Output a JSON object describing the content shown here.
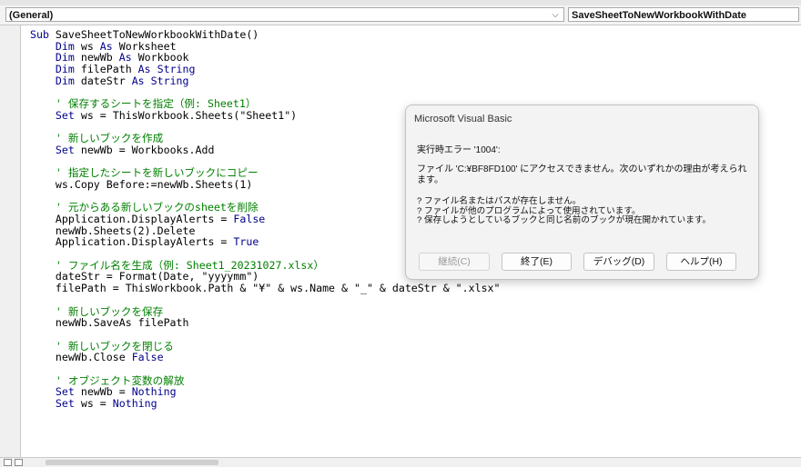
{
  "object_combo": {
    "value": "(General)",
    "arrow": "⌵"
  },
  "procedure_combo": {
    "value": "SaveSheetToNewWorkbookWithDate"
  },
  "code_lines": [
    [
      {
        "t": "Sub ",
        "c": "kw"
      },
      {
        "t": "SaveSheetToNewWorkbookWithDate()"
      }
    ],
    [
      {
        "t": "    "
      },
      {
        "t": "Dim ",
        "c": "kw"
      },
      {
        "t": "ws "
      },
      {
        "t": "As ",
        "c": "kw"
      },
      {
        "t": "Worksheet"
      }
    ],
    [
      {
        "t": "    "
      },
      {
        "t": "Dim ",
        "c": "kw"
      },
      {
        "t": "newWb "
      },
      {
        "t": "As ",
        "c": "kw"
      },
      {
        "t": "Workbook"
      }
    ],
    [
      {
        "t": "    "
      },
      {
        "t": "Dim ",
        "c": "kw"
      },
      {
        "t": "filePath "
      },
      {
        "t": "As String",
        "c": "kw"
      }
    ],
    [
      {
        "t": "    "
      },
      {
        "t": "Dim ",
        "c": "kw"
      },
      {
        "t": "dateStr "
      },
      {
        "t": "As String",
        "c": "kw"
      }
    ],
    [],
    [
      {
        "t": "    "
      },
      {
        "t": "' 保存するシートを指定（例: Sheet1）",
        "c": "cm"
      }
    ],
    [
      {
        "t": "    "
      },
      {
        "t": "Set ",
        "c": "kw"
      },
      {
        "t": "ws = ThisWorkbook.Sheets(\"Sheet1\")"
      }
    ],
    [],
    [
      {
        "t": "    "
      },
      {
        "t": "' 新しいブックを作成",
        "c": "cm"
      }
    ],
    [
      {
        "t": "    "
      },
      {
        "t": "Set ",
        "c": "kw"
      },
      {
        "t": "newWb = Workbooks.Add"
      }
    ],
    [],
    [
      {
        "t": "    "
      },
      {
        "t": "' 指定したシートを新しいブックにコピー",
        "c": "cm"
      }
    ],
    [
      {
        "t": "    ws.Copy Before:=newWb.Sheets(1)"
      }
    ],
    [],
    [
      {
        "t": "    "
      },
      {
        "t": "' 元からある新しいブックのsheetを削除",
        "c": "cm"
      }
    ],
    [
      {
        "t": "    Application.DisplayAlerts = "
      },
      {
        "t": "False",
        "c": "kw"
      }
    ],
    [
      {
        "t": "    newWb.Sheets(2).Delete"
      }
    ],
    [
      {
        "t": "    Application.DisplayAlerts = "
      },
      {
        "t": "True",
        "c": "kw"
      }
    ],
    [],
    [
      {
        "t": "    "
      },
      {
        "t": "' ファイル名を生成（例: Sheet1_20231027.xlsx）",
        "c": "cm"
      }
    ],
    [
      {
        "t": "    dateStr = Format(Date, \"yyyymm\")"
      }
    ],
    [
      {
        "t": "    filePath = ThisWorkbook.Path & \"¥\" & ws.Name & \"_\" & dateStr & \".xlsx\""
      }
    ],
    [],
    [
      {
        "t": "    "
      },
      {
        "t": "' 新しいブックを保存",
        "c": "cm"
      }
    ],
    [
      {
        "t": "    newWb.SaveAs filePath"
      }
    ],
    [],
    [
      {
        "t": "    "
      },
      {
        "t": "' 新しいブックを閉じる",
        "c": "cm"
      }
    ],
    [
      {
        "t": "    newWb.Close "
      },
      {
        "t": "False",
        "c": "kw"
      }
    ],
    [],
    [
      {
        "t": "    "
      },
      {
        "t": "' オブジェクト変数の解放",
        "c": "cm"
      }
    ],
    [
      {
        "t": "    "
      },
      {
        "t": "Set ",
        "c": "kw"
      },
      {
        "t": "newWb = "
      },
      {
        "t": "Nothing",
        "c": "kw"
      }
    ],
    [
      {
        "t": "    "
      },
      {
        "t": "Set ",
        "c": "kw"
      },
      {
        "t": "ws = "
      },
      {
        "t": "Nothing",
        "c": "kw"
      }
    ]
  ],
  "dialog": {
    "title": "Microsoft Visual Basic",
    "heading": "実行時エラー '1004':",
    "message": "ファイル 'C:¥BF8FD100' にアクセスできません。次のいずれかの理由が考えられます。",
    "reasons": [
      "? ファイル名またはパスが存在しません。",
      "? ファイルが他のプログラムによって使用されています。",
      "? 保存しようとしているブックと同じ名前のブックが現在開かれています。"
    ],
    "buttons": {
      "continue": "継続(C)",
      "end": "終了(E)",
      "debug": "デバッグ(D)",
      "help": "ヘルプ(H)"
    }
  },
  "colors": {
    "keyword": "#00008b",
    "comment": "#008000",
    "plain": "#000000"
  }
}
